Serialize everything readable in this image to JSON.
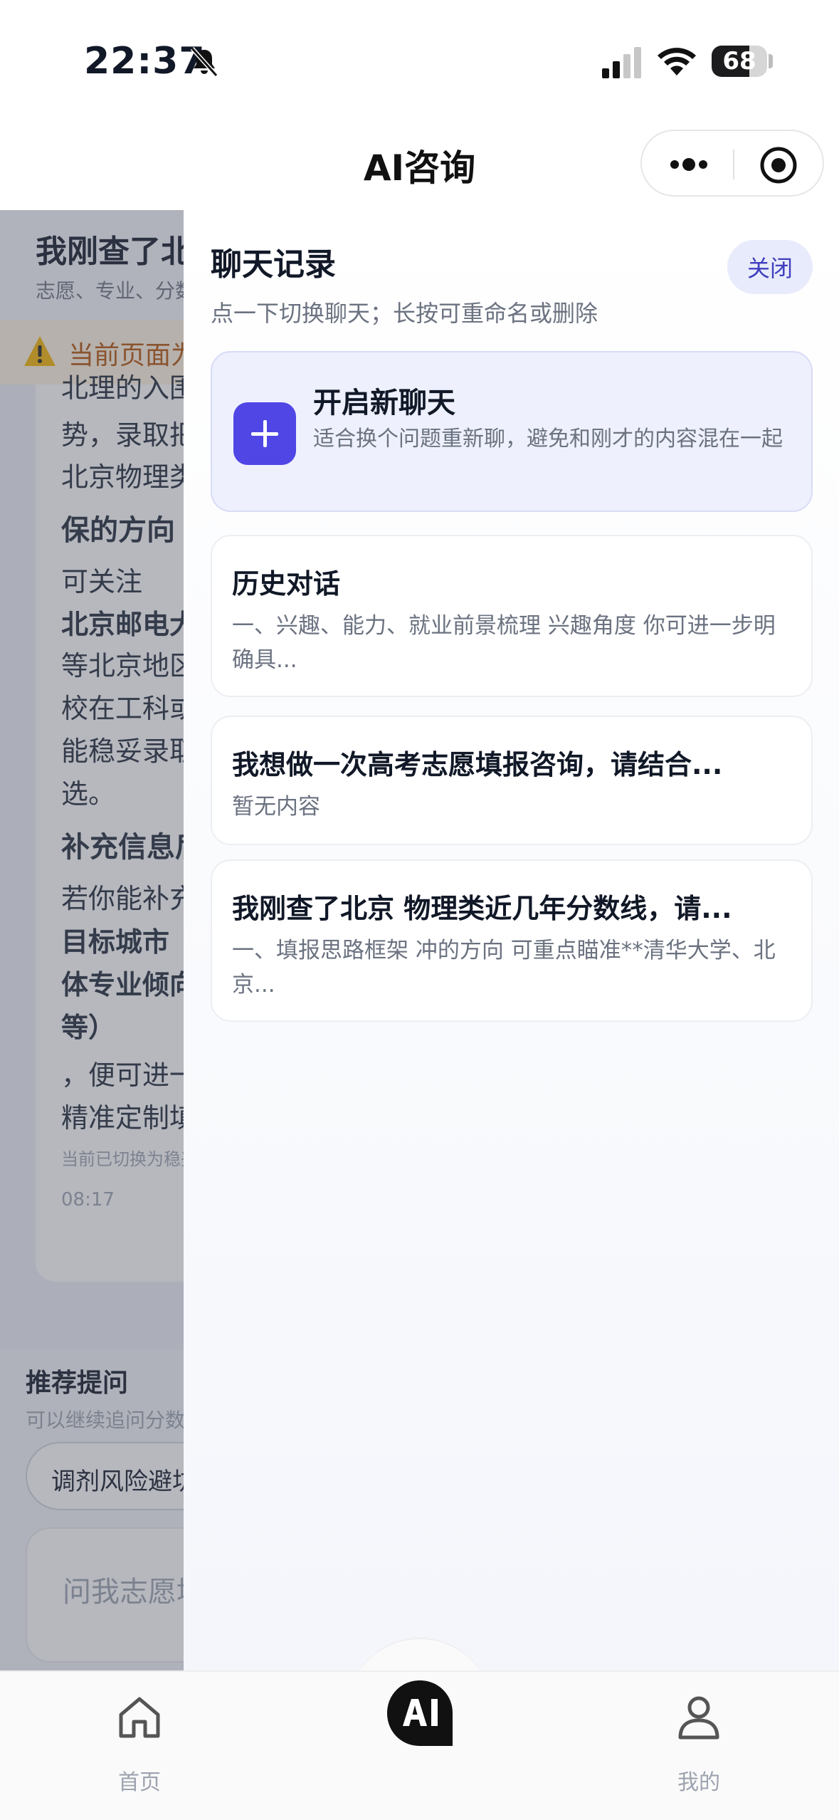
{
  "status_bar": {
    "time": "22:37",
    "battery": "68",
    "battery_level": 0.68
  },
  "nav": {
    "title": "AI咨询"
  },
  "background": {
    "header_title": "我刚查了北京 物理类近几年分数线",
    "header_subtitle": "志愿、专业、分数线",
    "warning": "当前页面为历史对话",
    "lines": [
      {
        "text": "北理的入围",
        "style": ""
      },
      {
        "text": "势，录取把握",
        "style": ""
      },
      {
        "text": "北京物理类",
        "style": ""
      },
      {
        "text": "保的方向",
        "style": "h"
      },
      {
        "text": "可关注",
        "style": ""
      },
      {
        "text": "北京邮电大学",
        "style": "b"
      },
      {
        "text": "等北京地区",
        "style": ""
      },
      {
        "text": "校在工科或",
        "style": ""
      },
      {
        "text": "能稳妥录取",
        "style": ""
      },
      {
        "text": "选。",
        "style": ""
      },
      {
        "text": "补充信息后",
        "style": "h"
      },
      {
        "text": "若你能补充",
        "style": ""
      },
      {
        "text": "目标城市",
        "style": "b"
      },
      {
        "text": "体专业倾向",
        "style": "b"
      },
      {
        "text": "等）",
        "style": "b"
      },
      {
        "text": "，便可进一步",
        "style": ""
      },
      {
        "text": "精准定制填报",
        "style": ""
      }
    ],
    "small_note": "当前已切换为稳妥模式",
    "time": "08:17",
    "suggest_title": "推荐提问",
    "suggest_sub": "可以继续追问分数线",
    "suggest_chip": "调剂风险避坑",
    "input_placeholder": "问我志愿填报"
  },
  "drawer": {
    "title": "聊天记录",
    "subtitle": "点一下切换聊天；长按可重命名或删除",
    "close_label": "关闭",
    "new_chat": {
      "title": "开启新聊天",
      "desc": "适合换个问题重新聊，避免和刚才的内容混在一起"
    },
    "items": [
      {
        "title": "历史对话",
        "preview": "一、兴趣、能力、就业前景梳理 兴趣角度 你可进一步明确具..."
      },
      {
        "title": "我想做一次高考志愿填报咨询，请结合...",
        "preview": "暂无内容"
      },
      {
        "title": "我刚查了北京 物理类近几年分数线，请...",
        "preview": "一、填报思路框架 冲的方向 可重点瞄准**清华大学、北京..."
      }
    ]
  },
  "tab_bar": {
    "home_label": "首页",
    "mine_label": "我的",
    "center_icon": "ai-icon"
  },
  "colors": {
    "accent": "#4f46e5",
    "close_bg": "#e8ebfb",
    "new_chat_bg": "#eef0fd"
  }
}
